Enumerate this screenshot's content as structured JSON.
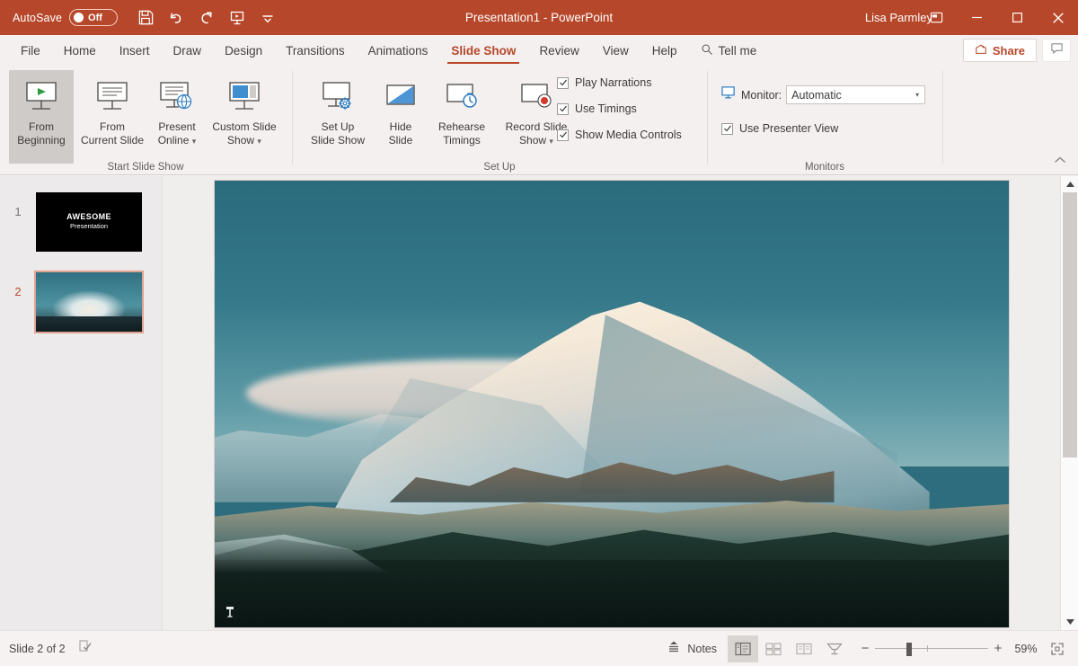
{
  "titlebar": {
    "autosave_label": "AutoSave",
    "autosave_state": "Off",
    "window_title": "Presentation1  -  PowerPoint",
    "user_name": "Lisa Parmley",
    "qat": [
      {
        "name": "save-icon",
        "label": "Save"
      },
      {
        "name": "undo-icon",
        "label": "Undo"
      },
      {
        "name": "redo-icon",
        "label": "Redo"
      },
      {
        "name": "start-from-beginning-icon",
        "label": "Start From Beginning"
      },
      {
        "name": "customize-quick-access-toolbar-icon",
        "label": "Customize Quick Access Toolbar"
      }
    ],
    "window_buttons": [
      {
        "name": "ribbon-display-options-button",
        "label": "Ribbon Display Options"
      },
      {
        "name": "minimize-button",
        "label": "Minimize"
      },
      {
        "name": "maximize-button",
        "label": "Maximize"
      },
      {
        "name": "close-button",
        "label": "Close"
      }
    ],
    "accent_color": "#b7472a"
  },
  "tabs": [
    {
      "label": "File",
      "active": false
    },
    {
      "label": "Home",
      "active": false
    },
    {
      "label": "Insert",
      "active": false
    },
    {
      "label": "Draw",
      "active": false
    },
    {
      "label": "Design",
      "active": false
    },
    {
      "label": "Transitions",
      "active": false
    },
    {
      "label": "Animations",
      "active": false
    },
    {
      "label": "Slide Show",
      "active": true
    },
    {
      "label": "Review",
      "active": false
    },
    {
      "label": "View",
      "active": false
    },
    {
      "label": "Help",
      "active": false
    }
  ],
  "tellme": {
    "label": "Tell me",
    "icon": "search-icon"
  },
  "share": {
    "label": "Share"
  },
  "comments": {
    "label": "Comments"
  },
  "ribbon": {
    "groups": [
      {
        "label": "Start Slide Show"
      },
      {
        "label": "Set Up"
      },
      {
        "label": "Monitors"
      }
    ],
    "start_slide_show": [
      {
        "line1": "From",
        "line2": "Beginning",
        "icon": "from-beginning-icon",
        "selected": true,
        "dropdown": false
      },
      {
        "line1": "From",
        "line2": "Current Slide",
        "icon": "from-current-slide-icon",
        "selected": false,
        "dropdown": false
      },
      {
        "line1": "Present",
        "line2": "Online",
        "icon": "present-online-icon",
        "selected": false,
        "dropdown": true
      },
      {
        "line1": "Custom Slide",
        "line2": "Show",
        "icon": "custom-slide-show-icon",
        "selected": false,
        "dropdown": true
      }
    ],
    "set_up_buttons": [
      {
        "line1": "Set Up",
        "line2": "Slide Show",
        "icon": "set-up-slide-show-icon",
        "dropdown": false
      },
      {
        "line1": "Hide",
        "line2": "Slide",
        "icon": "hide-slide-icon",
        "dropdown": false
      },
      {
        "line1": "Rehearse",
        "line2": "Timings",
        "icon": "rehearse-timings-icon",
        "dropdown": false
      },
      {
        "line1": "Record Slide",
        "line2": "Show",
        "icon": "record-slide-show-icon",
        "dropdown": true
      }
    ],
    "set_up_checks": [
      {
        "label": "Play Narrations",
        "checked": true
      },
      {
        "label": "Use Timings",
        "checked": true
      },
      {
        "label": "Show Media Controls",
        "checked": true
      }
    ],
    "monitors": {
      "monitor_label": "Monitor:",
      "monitor_value": "Automatic",
      "monitor_icon": "monitor-icon",
      "presenter_view_label": "Use Presenter View",
      "presenter_view_checked": true
    },
    "collapse_icon": "chevron-up-icon"
  },
  "thumbnails": [
    {
      "number": "1",
      "selected": false,
      "kind": "title",
      "title": "AWESOME",
      "subtitle": "Presentation"
    },
    {
      "number": "2",
      "selected": true,
      "kind": "image",
      "title": "",
      "subtitle": ""
    }
  ],
  "slide": {
    "marker_icon": "media-marker-icon"
  },
  "statusbar": {
    "slide_counter": "Slide 2 of 2",
    "accessibility_icon": "accessibility-checker-icon",
    "notes_label": "Notes",
    "notes_icon": "notes-icon",
    "views": [
      {
        "name": "normal-view-button",
        "label": "Normal",
        "active": true
      },
      {
        "name": "slide-sorter-view-button",
        "label": "Slide Sorter",
        "active": false
      },
      {
        "name": "reading-view-button",
        "label": "Reading View",
        "active": false
      },
      {
        "name": "slide-show-view-button",
        "label": "Slide Show",
        "active": false
      }
    ],
    "zoom_out_label": "−",
    "zoom_in_label": "+",
    "zoom_percent": "59%",
    "fit_icon": "fit-slide-to-window-icon"
  }
}
